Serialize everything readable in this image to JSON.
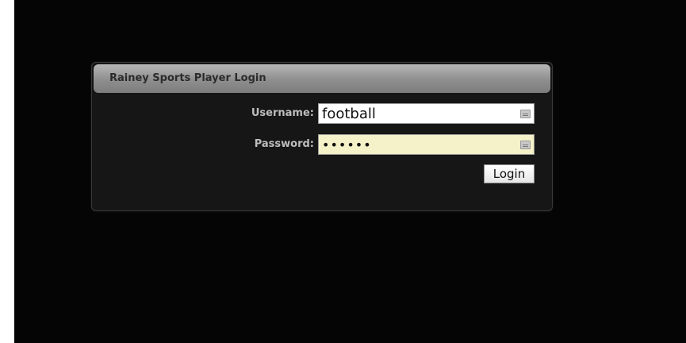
{
  "login_panel": {
    "title": "Rainey Sports Player Login",
    "username_label": "Username:",
    "username_value": "football",
    "password_label": "Password:",
    "password_value": "••••••",
    "login_button": "Login"
  },
  "colors": {
    "page_background": "#050505",
    "header_gradient_top": "#b6b6b6",
    "password_field_bg": "#f5f1c8"
  },
  "icons": {
    "field_icon": "keyboard-icon"
  }
}
